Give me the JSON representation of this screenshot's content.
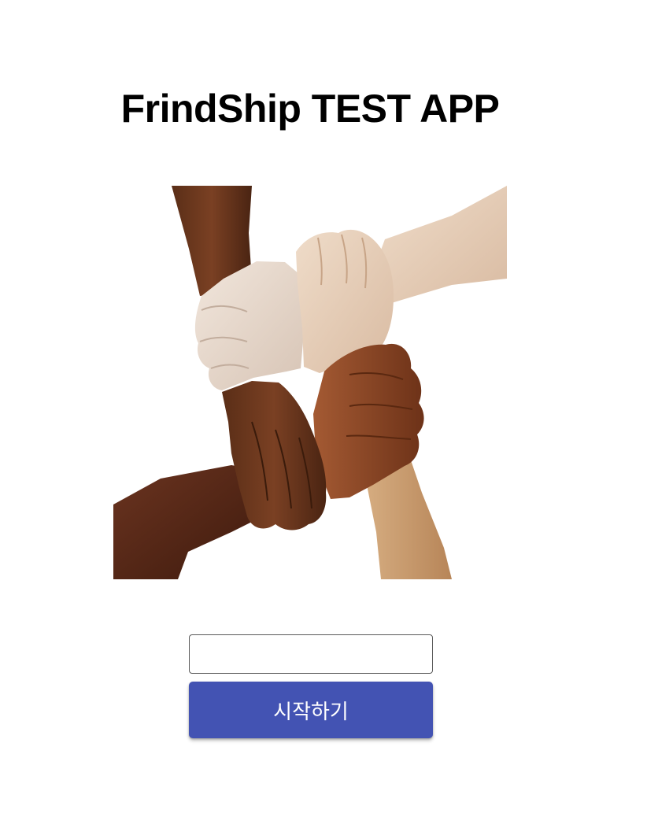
{
  "app": {
    "title": "FrindShip TEST APP"
  },
  "hero": {
    "image_label": "four interlocked hands gripping wrists"
  },
  "form": {
    "name_input_value": "",
    "name_input_placeholder": ""
  },
  "actions": {
    "start_label": "시작하기"
  },
  "colors": {
    "button_bg": "#4353b3",
    "button_text": "#ffffff",
    "title_text": "#000000",
    "page_bg": "#ffffff"
  }
}
